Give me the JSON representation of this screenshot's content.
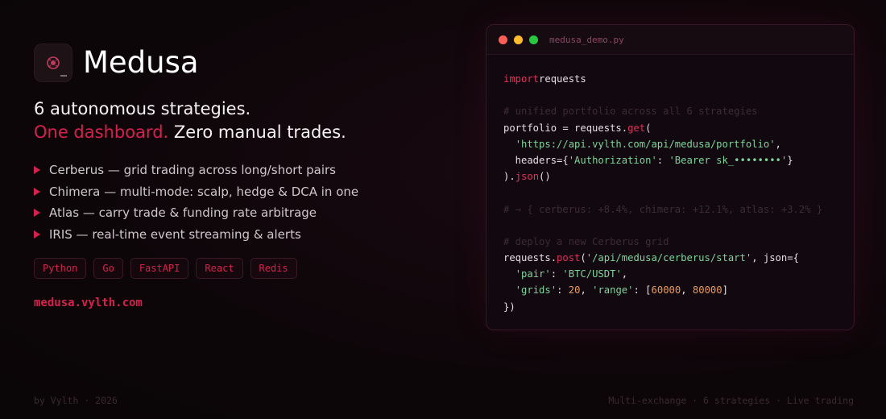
{
  "brand": {
    "name": "Medusa",
    "logo_icon": "medusa-logo-icon"
  },
  "tagline": {
    "line1": "6 autonomous strategies.",
    "highlight": "One dashboard.",
    "rest": " Zero manual trades."
  },
  "features": [
    "Cerberus — grid trading across long/short pairs",
    "Chimera — multi-mode: scalp, hedge & DCA in one",
    "Atlas — carry trade & funding rate arbitrage",
    "IRIS — real-time event streaming & alerts"
  ],
  "tech_chips": [
    "Python",
    "Go",
    "FastAPI",
    "React",
    "Redis"
  ],
  "site_url": "medusa.vylth.com",
  "editor": {
    "filename": "medusa_demo.py",
    "lines": [
      [
        [
          "kw",
          "import"
        ],
        [
          "",
          "requests"
        ]
      ],
      [],
      [
        [
          "cm",
          "# unified portfolio across all 6 strategies"
        ]
      ],
      [
        [
          "",
          "portfolio = requests."
        ],
        [
          "fn",
          "get"
        ],
        [
          "",
          "("
        ]
      ],
      [
        [
          "",
          "  "
        ],
        [
          "str",
          "'https://api.vylth.com/api/medusa/portfolio'"
        ],
        [
          "",
          ","
        ]
      ],
      [
        [
          "",
          "  headers={"
        ],
        [
          "str",
          "'Authorization'"
        ],
        [
          "",
          ": "
        ],
        [
          "str",
          "'Bearer sk_••••••••'"
        ],
        [
          "",
          "}"
        ]
      ],
      [
        [
          "",
          ")."
        ],
        [
          "fn",
          "json"
        ],
        [
          "",
          "()"
        ]
      ],
      [],
      [
        [
          "cm",
          "# → { cerberus: +8.4%, chimera: +12.1%, atlas: +3.2% }"
        ]
      ],
      [],
      [
        [
          "cm",
          "# deploy a new Cerberus grid"
        ]
      ],
      [
        [
          "",
          "requests."
        ],
        [
          "fn",
          "post"
        ],
        [
          "",
          "("
        ],
        [
          "str",
          "'/api/medusa/cerberus/start'"
        ],
        [
          "",
          ", json={"
        ]
      ],
      [
        [
          "",
          "  "
        ],
        [
          "str",
          "'pair'"
        ],
        [
          "",
          ": "
        ],
        [
          "str",
          "'BTC/USDT'"
        ],
        [
          "",
          ","
        ]
      ],
      [
        [
          "",
          "  "
        ],
        [
          "str",
          "'grids'"
        ],
        [
          "",
          ": "
        ],
        [
          "num",
          "20"
        ],
        [
          "",
          ", "
        ],
        [
          "str",
          "'range'"
        ],
        [
          "",
          ": ["
        ],
        [
          "num",
          "60000"
        ],
        [
          "",
          ", "
        ],
        [
          "num",
          "80000"
        ],
        [
          "",
          "]"
        ]
      ],
      [
        [
          "",
          "})"
        ]
      ]
    ]
  },
  "footer": {
    "left": "by Vylth · 2026",
    "right": "Multi-exchange · 6 strategies · Live trading"
  },
  "colors": {
    "accent": "#d6214f",
    "string": "#7fd49b",
    "number": "#e89b5a",
    "comment": "#3d2a33"
  }
}
